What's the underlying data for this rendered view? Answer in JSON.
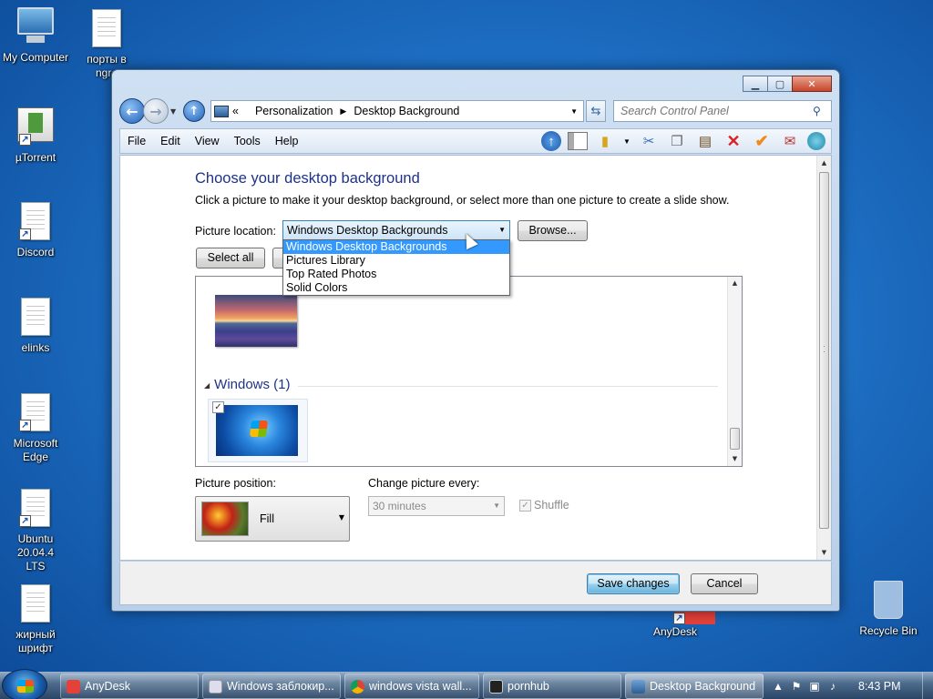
{
  "desktop": {
    "icons": [
      {
        "label": "My Computer"
      },
      {
        "label": "порты в ngro"
      },
      {
        "label": "µTorrent"
      },
      {
        "label": "Discord"
      },
      {
        "label": "elinks"
      },
      {
        "label": "Microsoft Edge"
      },
      {
        "label": "Ubuntu 20.04.4 LTS"
      },
      {
        "label": "жирный шрифт"
      },
      {
        "label": "AnyDesk"
      },
      {
        "label": "Recycle Bin"
      }
    ]
  },
  "window": {
    "breadcrumb": {
      "root_chevron": "«",
      "items": [
        "Personalization",
        "Desktop Background"
      ]
    },
    "search": {
      "placeholder": "Search Control Panel"
    },
    "menu": [
      "File",
      "Edit",
      "View",
      "Tools",
      "Help"
    ],
    "heading": "Choose your desktop background",
    "subheading": "Click a picture to make it your desktop background, or select more than one picture to create a slide show.",
    "picture_location": {
      "label": "Picture location:",
      "selected": "Windows Desktop Backgrounds",
      "options": [
        "Windows Desktop Backgrounds",
        "Pictures Library",
        "Top Rated Photos",
        "Solid Colors"
      ]
    },
    "browse_label": "Browse...",
    "select_all_label": "Select all",
    "group_label": "Windows (1)",
    "thumbnail_checked": true,
    "picture_position": {
      "label": "Picture position:",
      "value": "Fill"
    },
    "change_picture": {
      "label": "Change picture every:",
      "value": "30 minutes"
    },
    "shuffle_label": "Shuffle",
    "save_label": "Save changes",
    "cancel_label": "Cancel"
  },
  "taskbar": {
    "items": [
      {
        "label": "AnyDesk"
      },
      {
        "label": "Windows заблокир..."
      },
      {
        "label": "windows vista wall..."
      },
      {
        "label": "pornhub"
      },
      {
        "label": "Desktop Background"
      }
    ],
    "clock": "8:43 PM"
  },
  "colors": {
    "accent": "#3399ff",
    "heading": "#1e3287",
    "close_button": "#c7432a"
  }
}
